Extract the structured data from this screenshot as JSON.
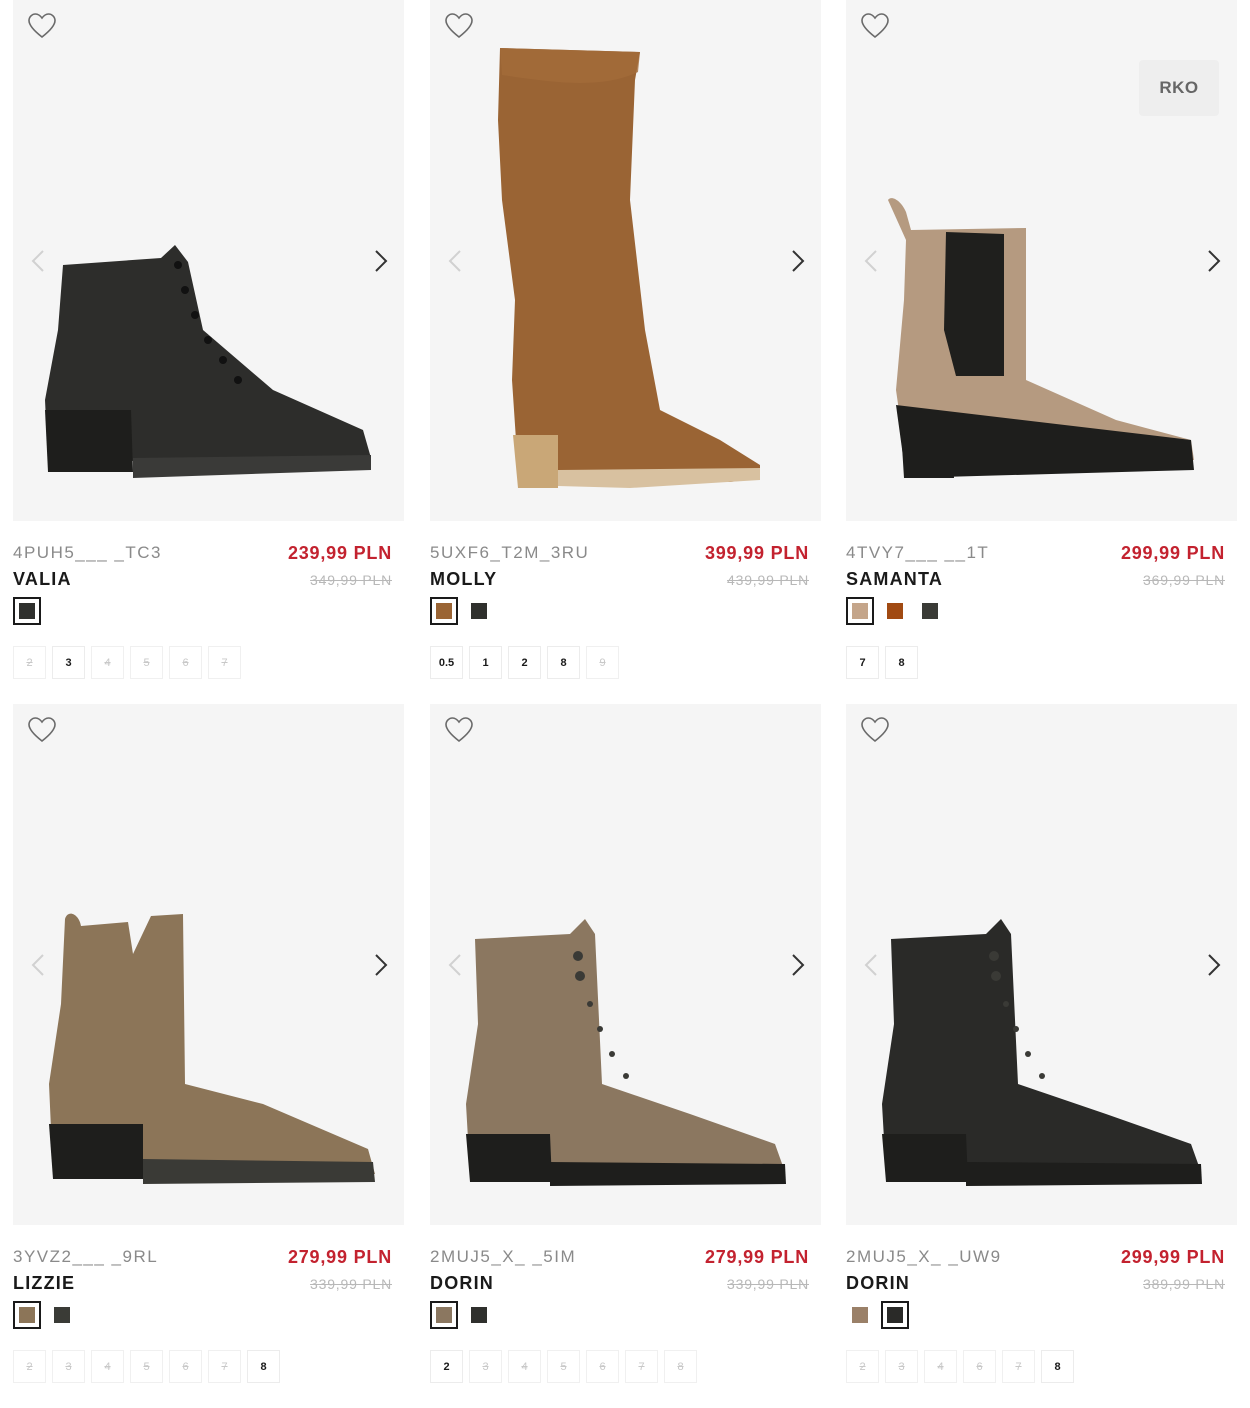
{
  "colors": {
    "price_red": "#c3222f",
    "old_price_gray": "#b8b8b8",
    "sku_gray": "#8a8a8a",
    "image_background": "#f5f5f5"
  },
  "icons": {
    "favorite": "heart-outline-icon",
    "prev": "chevron-left-icon",
    "next": "chevron-right-icon"
  },
  "products": [
    {
      "sku": "4PUH5___ _TC3",
      "name": "VALIA",
      "price": "239,99 PLN",
      "old_price": "349,99 PLN",
      "badge": "",
      "shoe_style": "lace-ankle",
      "shoe_color": "#2d2d2b",
      "swatches": [
        {
          "color": "#2f302d",
          "selected": true
        }
      ],
      "sizes": [
        {
          "label": "2",
          "available": false
        },
        {
          "label": "3",
          "available": true
        },
        {
          "label": "4",
          "available": false
        },
        {
          "label": "5",
          "available": false
        },
        {
          "label": "6",
          "available": false
        },
        {
          "label": "7",
          "available": false
        }
      ]
    },
    {
      "sku": "5UXF6_T2M_3RU",
      "name": "MOLLY",
      "price": "399,99 PLN",
      "old_price": "439,99 PLN",
      "badge": "",
      "shoe_style": "knee-boot",
      "shoe_color": "#9a6434",
      "swatches": [
        {
          "color": "#9a6434",
          "selected": true
        },
        {
          "color": "#2f302d",
          "selected": false
        }
      ],
      "sizes": [
        {
          "label": "0.5",
          "available": true
        },
        {
          "label": "1",
          "available": true
        },
        {
          "label": "2",
          "available": true
        },
        {
          "label": "8",
          "available": true
        },
        {
          "label": "9",
          "available": false
        }
      ]
    },
    {
      "sku": "4TVY7___ __1T",
      "name": "SAMANTA",
      "price": "299,99 PLN",
      "old_price": "369,99 PLN",
      "badge": "RKO",
      "shoe_style": "chelsea",
      "shoe_color": "#b59a80",
      "swatches": [
        {
          "color": "#c4a58a",
          "selected": true
        },
        {
          "color": "#a14a12",
          "selected": false
        },
        {
          "color": "#3a3b36",
          "selected": false
        }
      ],
      "sizes": [
        {
          "label": "7",
          "available": true
        },
        {
          "label": "8",
          "available": true
        }
      ]
    },
    {
      "sku": "3YVZ2___ _9RL",
      "name": "LIZZIE",
      "price": "279,99 PLN",
      "old_price": "339,99 PLN",
      "badge": "",
      "shoe_style": "v-ankle",
      "shoe_color": "#8c7558",
      "swatches": [
        {
          "color": "#8c7558",
          "selected": true
        },
        {
          "color": "#3a3b36",
          "selected": false
        }
      ],
      "sizes": [
        {
          "label": "2",
          "available": false
        },
        {
          "label": "3",
          "available": false
        },
        {
          "label": "4",
          "available": false
        },
        {
          "label": "5",
          "available": false
        },
        {
          "label": "6",
          "available": false
        },
        {
          "label": "7",
          "available": false
        },
        {
          "label": "8",
          "available": true
        }
      ]
    },
    {
      "sku": "2MUJ5_X_ _5IM",
      "name": "DORIN",
      "price": "279,99 PLN",
      "old_price": "339,99 PLN",
      "badge": "",
      "shoe_style": "combat",
      "shoe_color": "#8b7760",
      "swatches": [
        {
          "color": "#8b7760",
          "selected": true
        },
        {
          "color": "#2f302d",
          "selected": false
        }
      ],
      "sizes": [
        {
          "label": "2",
          "available": true
        },
        {
          "label": "3",
          "available": false
        },
        {
          "label": "4",
          "available": false
        },
        {
          "label": "5",
          "available": false
        },
        {
          "label": "6",
          "available": false
        },
        {
          "label": "7",
          "available": false
        },
        {
          "label": "8",
          "available": false
        }
      ]
    },
    {
      "sku": "2MUJ5_X_ _UW9",
      "name": "DORIN",
      "price": "299,99 PLN",
      "old_price": "389,99 PLN",
      "badge": "",
      "shoe_style": "combat",
      "shoe_color": "#2a2a28",
      "swatches": [
        {
          "color": "#9a8068",
          "selected": false
        },
        {
          "color": "#2a2a28",
          "selected": true
        }
      ],
      "sizes": [
        {
          "label": "2",
          "available": false
        },
        {
          "label": "3",
          "available": false
        },
        {
          "label": "4",
          "available": false
        },
        {
          "label": "6",
          "available": false
        },
        {
          "label": "7",
          "available": false
        },
        {
          "label": "8",
          "available": true
        }
      ]
    }
  ]
}
